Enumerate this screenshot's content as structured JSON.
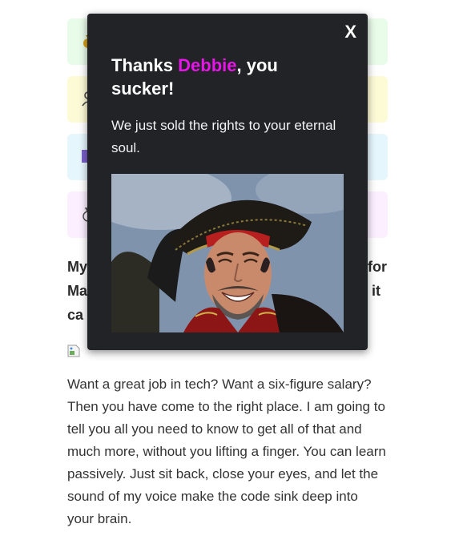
{
  "options": [
    {
      "bg": "#e9fbe9",
      "icon": "money-bag-icon"
    },
    {
      "bg": "#fdfbd6",
      "icon": "user-icon"
    },
    {
      "bg": "#e6f6fd",
      "icon": "purple-square-icon"
    },
    {
      "bg": "#fcefff",
      "icon": "money-bag-icon"
    }
  ],
  "heading_fragments": {
    "line1_left": "My",
    "line1_right": "for",
    "line2_left": "Ma",
    "line2_right": "it",
    "line3_left": "ca"
  },
  "article": {
    "body": "Want a great job in tech? Want a six-figure salary? Then you have come to the right place. I am going to tell you all you need to know to get all of that and much more, without you lifting a finger. You can learn passively. Just sit back, close your eyes, and let the sound of my voice make the code sink deep into your brain."
  },
  "modal": {
    "close_label": "X",
    "title_prefix": "Thanks ",
    "title_name": "Debbie",
    "title_suffix": ", you sucker!",
    "message": "We just sold the rights to your eternal soul.",
    "image_icon": "pirate-gif-image",
    "accent_color": "#e815e8",
    "background_color": "#212327"
  }
}
